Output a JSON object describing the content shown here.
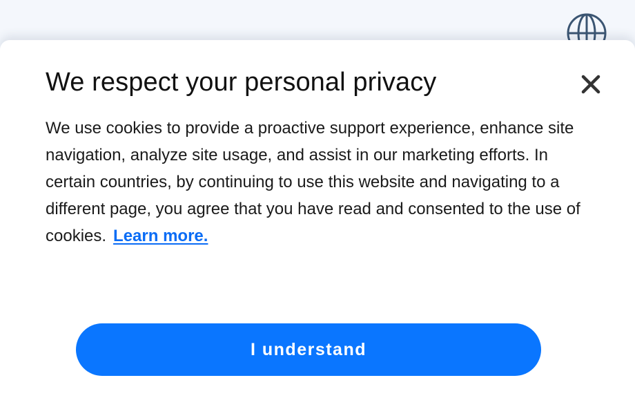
{
  "header": {
    "language_icon": "globe-icon"
  },
  "cookie_modal": {
    "title": "We respect your personal privacy",
    "close_icon": "close-icon",
    "body_text": "We use cookies to provide a proactive support experience, enhance site navigation, analyze site usage, and assist in our marketing efforts. In certain countries, by continuing to use this website and navigating to a different page, you agree that you have read and consented to the use of cookies.",
    "learn_more_label": "Learn more.",
    "accept_button_label": "I understand"
  },
  "colors": {
    "accent": "#0a76ff",
    "link": "#0a6cf5",
    "icon": "#3b5572"
  }
}
